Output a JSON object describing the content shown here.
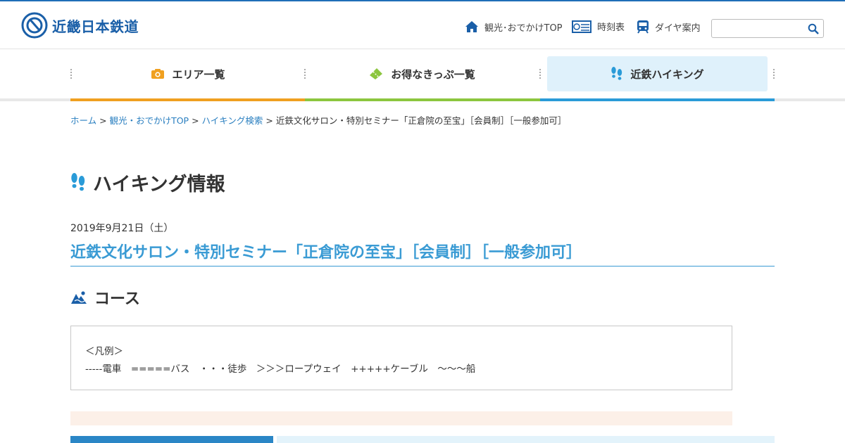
{
  "header": {
    "logo_text": "近畿日本鉄道",
    "nav": [
      {
        "label": "観光･おでかけTOP",
        "icon": "home-icon"
      },
      {
        "label": "時刻表",
        "icon": "timetable-icon"
      },
      {
        "label": "ダイヤ案内",
        "icon": "train-icon"
      }
    ],
    "search_placeholder": ""
  },
  "main_nav": [
    {
      "label": "エリア一覧",
      "icon": "camera-icon",
      "color": "#f0a020"
    },
    {
      "label": "お得なきっぷ一覧",
      "icon": "ticket-icon",
      "color": "#8cc63f"
    },
    {
      "label": "近鉄ハイキング",
      "icon": "footprints-icon",
      "color": "#2a9bd8",
      "active": true
    }
  ],
  "breadcrumb": {
    "items": [
      "ホーム",
      "観光・おでかけTOP",
      "ハイキング検索"
    ],
    "current": "近鉄文化サロン・特別セミナー「正倉院の至宝」［会員制］［一般参加可］"
  },
  "page": {
    "heading": "ハイキング情報",
    "date": "2019年9月21日（土）",
    "event_title": "近鉄文化サロン・特別セミナー「正倉院の至宝」［会員制］［一般参加可］",
    "course_heading": "コース",
    "legend_title": "＜凡例＞",
    "legend_body": "-----電車　=====バス　・・・徒歩　＞＞＞ロープウェイ　+++++ケーブル　〜〜〜船"
  }
}
